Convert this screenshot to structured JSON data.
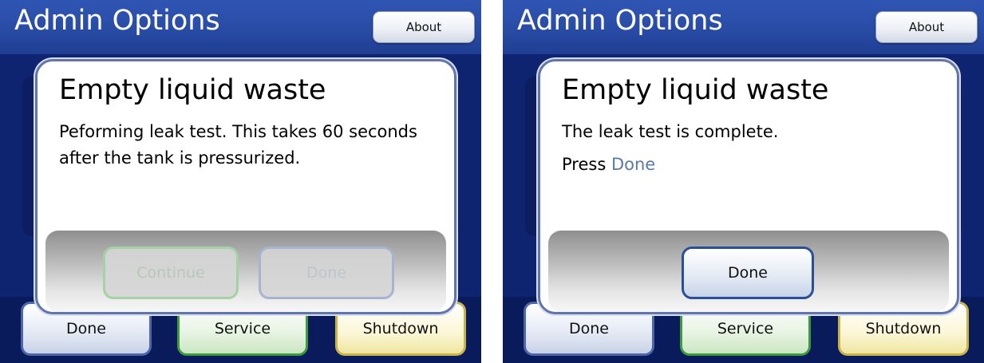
{
  "colors": {
    "header_blue": "#2a4ea8",
    "background_navy": "#0f2470",
    "done_accent": "#5a78b0"
  },
  "screens": [
    {
      "header": {
        "title": "Admin Options",
        "about_label": "About"
      },
      "dialog": {
        "title": "Empty liquid waste",
        "message": "Peforming leak test.  This takes 60 seconds after the tank is pressurized.",
        "buttons": {
          "continue_label": "Continue",
          "done_label": "Done"
        }
      },
      "bottom": {
        "done_label": "Done",
        "service_label": "Service",
        "shutdown_label": "Shutdown"
      }
    },
    {
      "header": {
        "title": "Admin Options",
        "about_label": "About"
      },
      "dialog": {
        "title": "Empty liquid waste",
        "message": "The leak test is complete.",
        "press_prefix": "Press",
        "press_link": "Done",
        "buttons": {
          "done_label": "Done"
        }
      },
      "bottom": {
        "done_label": "Done",
        "service_label": "Service",
        "shutdown_label": "Shutdown"
      }
    }
  ]
}
